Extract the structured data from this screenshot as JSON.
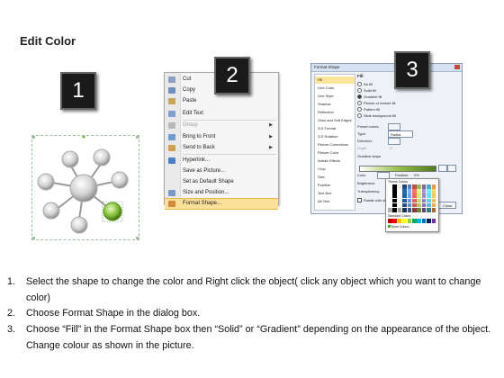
{
  "title": "Edit Color",
  "badges": [
    "1",
    "2",
    "3"
  ],
  "context_menu": {
    "items": [
      {
        "label": "Cut",
        "disabled": false,
        "submenu": false,
        "highlight": false,
        "icon": "scissors-icon"
      },
      {
        "label": "Copy",
        "disabled": false,
        "submenu": false,
        "highlight": false,
        "icon": "copy-icon"
      },
      {
        "label": "Paste",
        "disabled": false,
        "submenu": false,
        "highlight": false,
        "icon": "paste-icon"
      },
      {
        "label": "Edit Text",
        "disabled": false,
        "submenu": false,
        "highlight": false,
        "icon": "edit-text-icon"
      },
      {
        "label": "Group",
        "disabled": true,
        "submenu": true,
        "highlight": false,
        "icon": "group-icon"
      },
      {
        "label": "Bring to Front",
        "disabled": false,
        "submenu": true,
        "highlight": false,
        "icon": "bring-front-icon"
      },
      {
        "label": "Send to Back",
        "disabled": false,
        "submenu": true,
        "highlight": false,
        "icon": "send-back-icon"
      },
      {
        "label": "Hyperlink...",
        "disabled": false,
        "submenu": false,
        "highlight": false,
        "icon": "hyperlink-icon"
      },
      {
        "label": "Save as Picture...",
        "disabled": false,
        "submenu": false,
        "highlight": false,
        "icon": ""
      },
      {
        "label": "Set as Default Shape",
        "disabled": false,
        "submenu": false,
        "highlight": false,
        "icon": ""
      },
      {
        "label": "Size and Position...",
        "disabled": false,
        "submenu": false,
        "highlight": false,
        "icon": "size-position-icon"
      },
      {
        "label": "Format Shape...",
        "disabled": false,
        "submenu": false,
        "highlight": true,
        "icon": "format-shape-icon"
      }
    ]
  },
  "format_dialog": {
    "title": "Format Shape",
    "categories": [
      "Fill",
      "Line Color",
      "Line Style",
      "Shadow",
      "Reflection",
      "Glow and Soft Edges",
      "3-D Format",
      "3-D Rotation",
      "Picture Corrections",
      "Picture Color",
      "Artistic Effects",
      "Crop",
      "Size",
      "Position",
      "Text Box",
      "Alt Text"
    ],
    "section_label": "Fill",
    "fill_options": [
      "No fill",
      "Solid fill",
      "Gradient fill",
      "Picture or texture fill",
      "Pattern fill",
      "Slide background fill"
    ],
    "selected_fill": "Gradient fill",
    "preset_colors_label": "Preset colors:",
    "type_label": "Type:",
    "type_value": "Radial",
    "direction_label": "Direction:",
    "angle_label": "Angle:",
    "angle_value": "0°",
    "gradient_stops_label": "Gradient stops",
    "color_label": "Color",
    "position_label": "Position:",
    "position_value": "0%",
    "brightness_label": "Brightness:",
    "transparency_label": "Transparency:",
    "rotate_label": "Rotate with shape",
    "close_button": "Close",
    "palette": {
      "theme_colors_label": "Theme Colors",
      "standard_colors_label": "Standard Colors",
      "more_colors_label": "More Colors...",
      "theme_colors": [
        "#ffffff",
        "#000000",
        "#eeece1",
        "#1f497d",
        "#4f81bd",
        "#c0504d",
        "#9bbb59",
        "#8064a2",
        "#4bacc6",
        "#f79646"
      ],
      "standard_colors": [
        "#c00000",
        "#ff0000",
        "#ffc000",
        "#ffff00",
        "#92d050",
        "#00b050",
        "#00b0f0",
        "#0070c0",
        "#002060",
        "#7030a0"
      ]
    }
  },
  "instructions": [
    {
      "num": "1.",
      "text": "Select the shape to change the color and Right click the object( click any object which you want to change color)"
    },
    {
      "num": "2.",
      "text": "Choose Format Shape in the dialog box."
    },
    {
      "num": "3.",
      "text": "Choose “Fill” in the Format Shape box then “Solid” or “Gradient” depending on the appearance of the object. Change colour as shown in the picture."
    }
  ],
  "colors": {
    "accent_green": "#7ab82e",
    "menu_highlight": "#fbe09a",
    "badge_bg": "#1a1a1a"
  }
}
